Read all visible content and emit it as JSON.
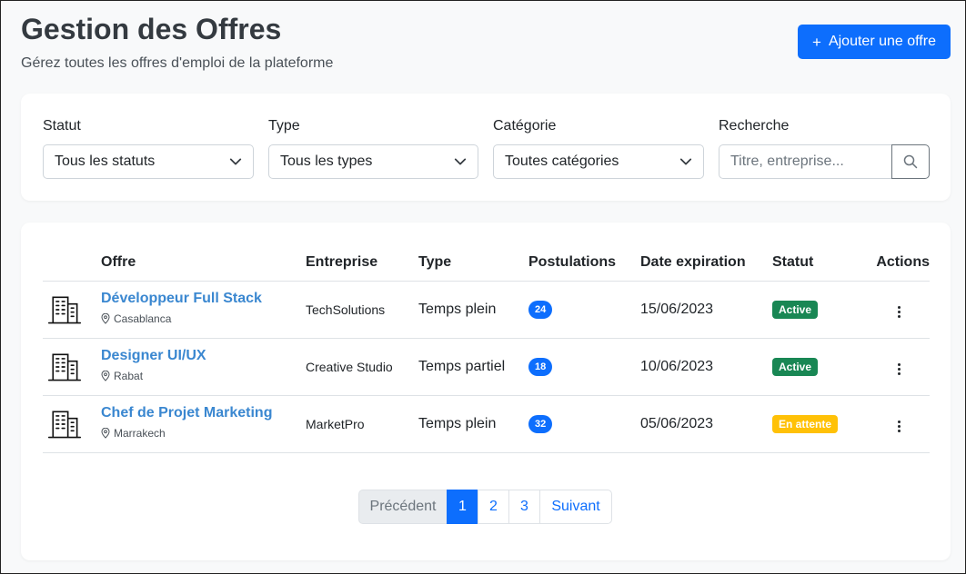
{
  "header": {
    "title": "Gestion des Offres",
    "subtitle": "Gérez toutes les offres d'emploi de la plateforme",
    "add_button": "Ajouter une offre"
  },
  "filters": {
    "status": {
      "label": "Statut",
      "value": "Tous les statuts"
    },
    "type": {
      "label": "Type",
      "value": "Tous les types"
    },
    "category": {
      "label": "Catégorie",
      "value": "Toutes catégories"
    },
    "search": {
      "label": "Recherche",
      "placeholder": "Titre, entreprise..."
    }
  },
  "table": {
    "columns": [
      "Offre",
      "Entreprise",
      "Type",
      "Postulations",
      "Date expiration",
      "Statut",
      "Actions"
    ],
    "rows": [
      {
        "title": "Développeur Full Stack",
        "location": "Casablanca",
        "company": "TechSolutions",
        "type": "Temps plein",
        "applications": "24",
        "expiration": "15/06/2023",
        "status": "Active",
        "status_color": "#198754",
        "status_text_color": "#ffffff"
      },
      {
        "title": "Designer UI/UX",
        "location": "Rabat",
        "company": "Creative Studio",
        "type": "Temps partiel",
        "applications": "18",
        "expiration": "10/06/2023",
        "status": "Active",
        "status_color": "#198754",
        "status_text_color": "#ffffff"
      },
      {
        "title": "Chef de Projet Marketing",
        "location": "Marrakech",
        "company": "MarketPro",
        "type": "Temps plein",
        "applications": "32",
        "expiration": "05/06/2023",
        "status": "En attente",
        "status_color": "#ffc107",
        "status_text_color": "#ffffff"
      }
    ]
  },
  "pagination": {
    "previous": "Précédent",
    "pages": [
      "1",
      "2",
      "3"
    ],
    "active_page": "1",
    "next": "Suivant"
  },
  "colors": {
    "accent": "#0d6efd",
    "title_link": "#3a87d0",
    "active_status": "#198754",
    "pending_status": "#ffc107"
  },
  "icons": {
    "add": "plus-icon",
    "select": "chevron-down-icon",
    "search": "search-icon",
    "offer": "building-icon",
    "location": "map-pin-icon",
    "actions": "more-vertical-icon"
  }
}
